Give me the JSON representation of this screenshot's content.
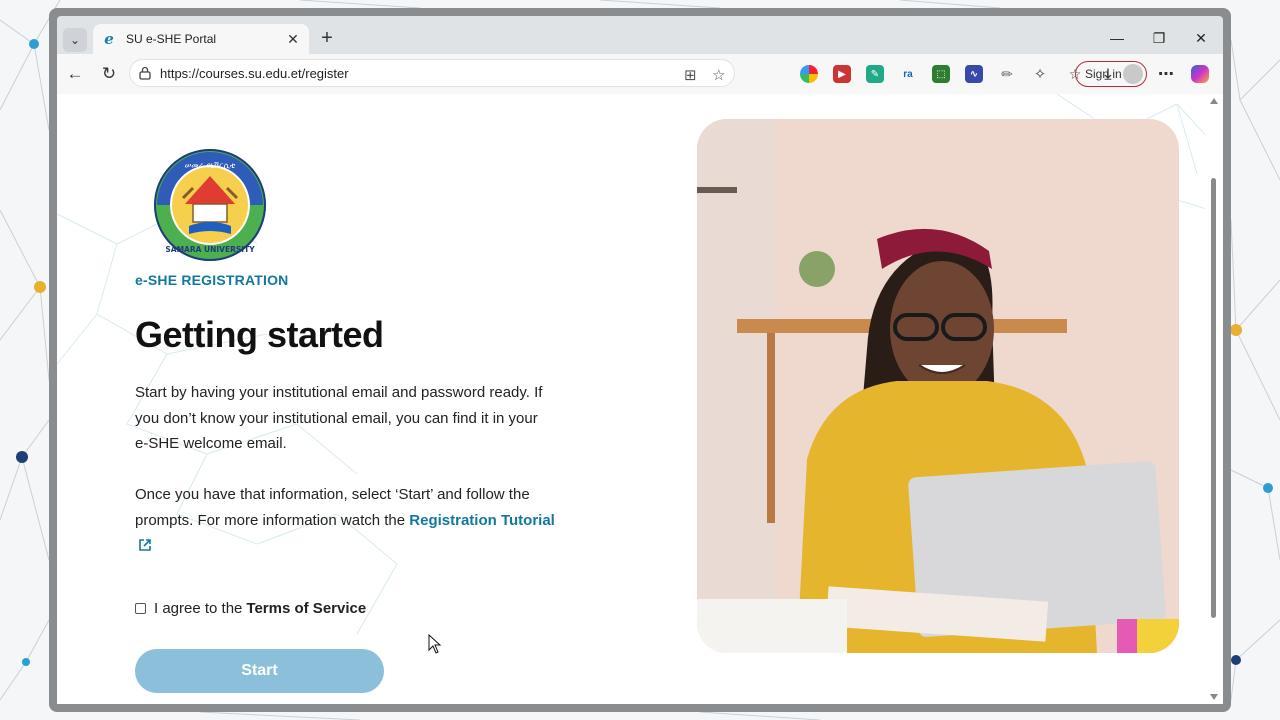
{
  "browser": {
    "tab_title": "SU e-SHE Portal",
    "url": "https://courses.su.edu.et/register",
    "sign_in_label": "Sign in"
  },
  "page": {
    "logo_text_top": "ሠመራ ዩኒቨርሲቲ",
    "logo_text_bottom": "SAMARA UNIVERSITY",
    "eyebrow": "e-SHE REGISTRATION",
    "heading": "Getting started",
    "para1": "Start by having your institutional email and password ready. If you don’t know your institutional email, you can find it in your e-SHE welcome email.",
    "para2_prefix": "Once you have that information, select ‘Start’ and follow the prompts. For more information watch the ",
    "para2_link": "Registration Tutorial",
    "agree_prefix": "I agree to the",
    "agree_terms": "Terms of Service",
    "start_label": "Start"
  },
  "colors": {
    "accent": "#1378a0",
    "start_button": "#8cbfda",
    "signin_border": "#b22d3a"
  }
}
